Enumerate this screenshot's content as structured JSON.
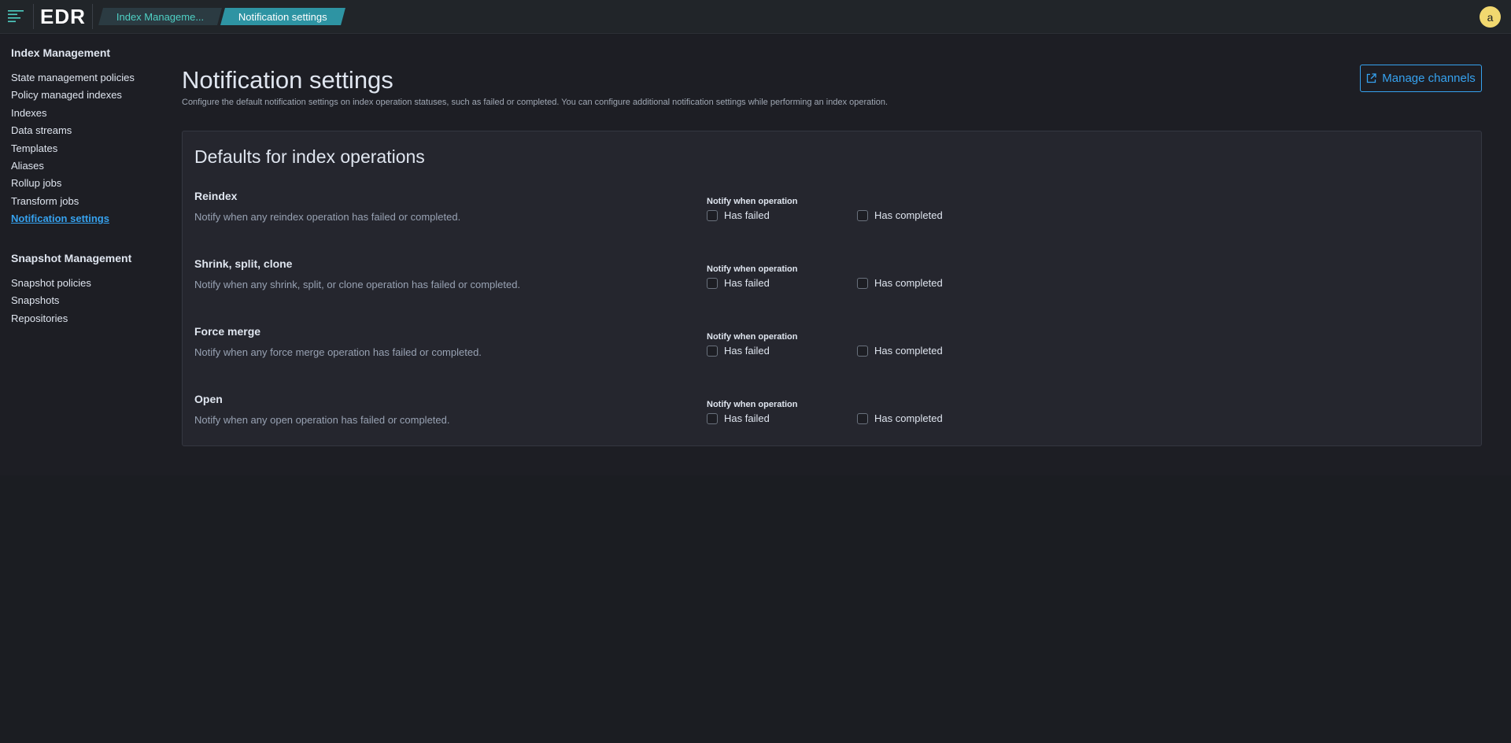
{
  "header": {
    "logo": "EDR",
    "breadcrumbs": [
      "Index Manageme...",
      "Notification settings"
    ],
    "avatar_initial": "a"
  },
  "sidebar": {
    "groups": [
      {
        "title": "Index Management",
        "items": [
          "State management policies",
          "Policy managed indexes",
          "Indexes",
          "Data streams",
          "Templates",
          "Aliases",
          "Rollup jobs",
          "Transform jobs",
          "Notification settings"
        ],
        "active": "Notification settings"
      },
      {
        "title": "Snapshot Management",
        "items": [
          "Snapshot policies",
          "Snapshots",
          "Repositories"
        ]
      }
    ]
  },
  "main": {
    "title": "Notification settings",
    "description": "Configure the default notification settings on index operation statuses, such as failed or completed. You can configure additional notification settings while performing an index operation.",
    "manage_channels_label": "Manage channels",
    "panel_title": "Defaults for index operations",
    "operations": [
      {
        "name": "Reindex",
        "description": "Notify when any reindex operation has failed or completed.",
        "notify_label": "Notify when operation",
        "failed_label": "Has failed",
        "completed_label": "Has completed",
        "failed_checked": false,
        "completed_checked": false
      },
      {
        "name": "Shrink, split, clone",
        "description": "Notify when any shrink, split, or clone operation has failed or completed.",
        "notify_label": "Notify when operation",
        "failed_label": "Has failed",
        "completed_label": "Has completed",
        "failed_checked": false,
        "completed_checked": false
      },
      {
        "name": "Force merge",
        "description": "Notify when any force merge operation has failed or completed.",
        "notify_label": "Notify when operation",
        "failed_label": "Has failed",
        "completed_label": "Has completed",
        "failed_checked": false,
        "completed_checked": false
      },
      {
        "name": "Open",
        "description": "Notify when any open operation has failed or completed.",
        "notify_label": "Notify when operation",
        "failed_label": "Has failed",
        "completed_label": "Has completed",
        "failed_checked": false,
        "completed_checked": false
      }
    ]
  },
  "colors": {
    "accent": "#36a2ef",
    "teal": "#4fd1c5",
    "breadcrumb_active": "#2e94a3",
    "avatar": "#f1d86f",
    "background": "#1b1d22",
    "panel": "#25262e"
  }
}
